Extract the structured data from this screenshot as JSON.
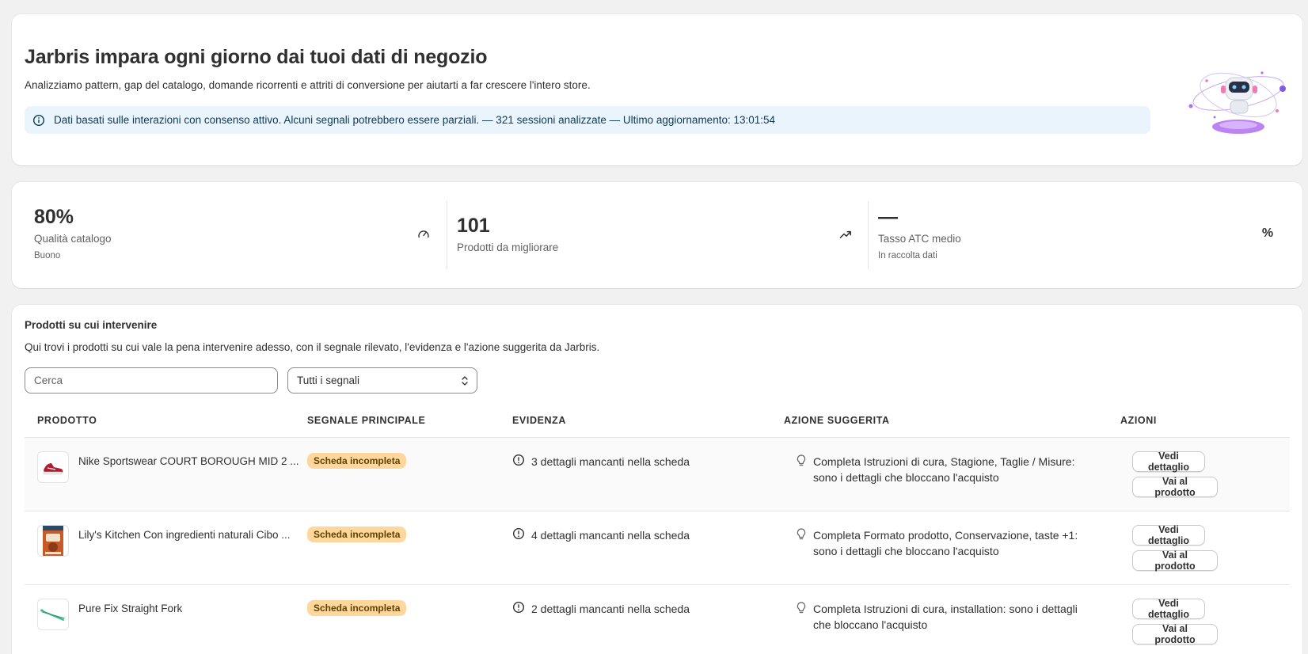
{
  "hero": {
    "title": "Jarbris impara ogni giorno dai tuoi dati di negozio",
    "subtitle": "Analizziamo pattern, gap del catalogo, domande ricorrenti e attriti di conversione per aiutarti a far crescere l'intero store.",
    "banner": "Dati basati sulle interazioni con consenso attivo. Alcuni segnali potrebbero essere parziali. — 321 sessioni analizzate — Ultimo aggiornamento: 13:01:54"
  },
  "stats": [
    {
      "value": "80%",
      "label": "Qualità catalogo",
      "note": "Buono",
      "icon": "gauge-icon"
    },
    {
      "value": "101",
      "label": "Prodotti da migliorare",
      "note": "",
      "icon": "trending-up-icon"
    },
    {
      "value": "—",
      "label": "Tasso ATC medio",
      "note": "In raccolta dati",
      "icon": "percent-icon"
    }
  ],
  "products": {
    "title": "Prodotti su cui intervenire",
    "subtitle": "Qui trovi i prodotti su cui vale la pena intervenire adesso, con il segnale rilevato, l'evidenza e l'azione suggerita da Jarbris.",
    "search_placeholder": "Cerca",
    "filter_value": "Tutti i segnali",
    "columns": [
      "PRODOTTO",
      "SEGNALE PRINCIPALE",
      "EVIDENZA",
      "AZIONE SUGGERITA",
      "AZIONI"
    ],
    "rows": [
      {
        "name": "Nike Sportswear COURT BOROUGH MID 2 ...",
        "signal": "Scheda incompleta",
        "evidence": "3 dettagli mancanti nella scheda",
        "action": "Completa Istruzioni di cura, Stagione, Taglie / Misure: sono i dettagli che bloccano l'acquisto",
        "btn_detail": "Vedi dettaglio",
        "btn_product": "Vai al prodotto"
      },
      {
        "name": "Lily's Kitchen Con ingredienti naturali Cibo ...",
        "signal": "Scheda incompleta",
        "evidence": "4 dettagli mancanti nella scheda",
        "action": "Completa Formato prodotto, Conservazione, taste +1: sono i dettagli che bloccano l'acquisto",
        "btn_detail": "Vedi dettaglio",
        "btn_product": "Vai al prodotto"
      },
      {
        "name": "Pure Fix Straight Fork",
        "signal": "Scheda incompleta",
        "evidence": "2 dettagli mancanti nella scheda",
        "action": "Completa Istruzioni di cura, installation: sono i dettagli che bloccano l'acquisto",
        "btn_detail": "Vedi dettaglio",
        "btn_product": "Vai al prodotto"
      }
    ]
  }
}
